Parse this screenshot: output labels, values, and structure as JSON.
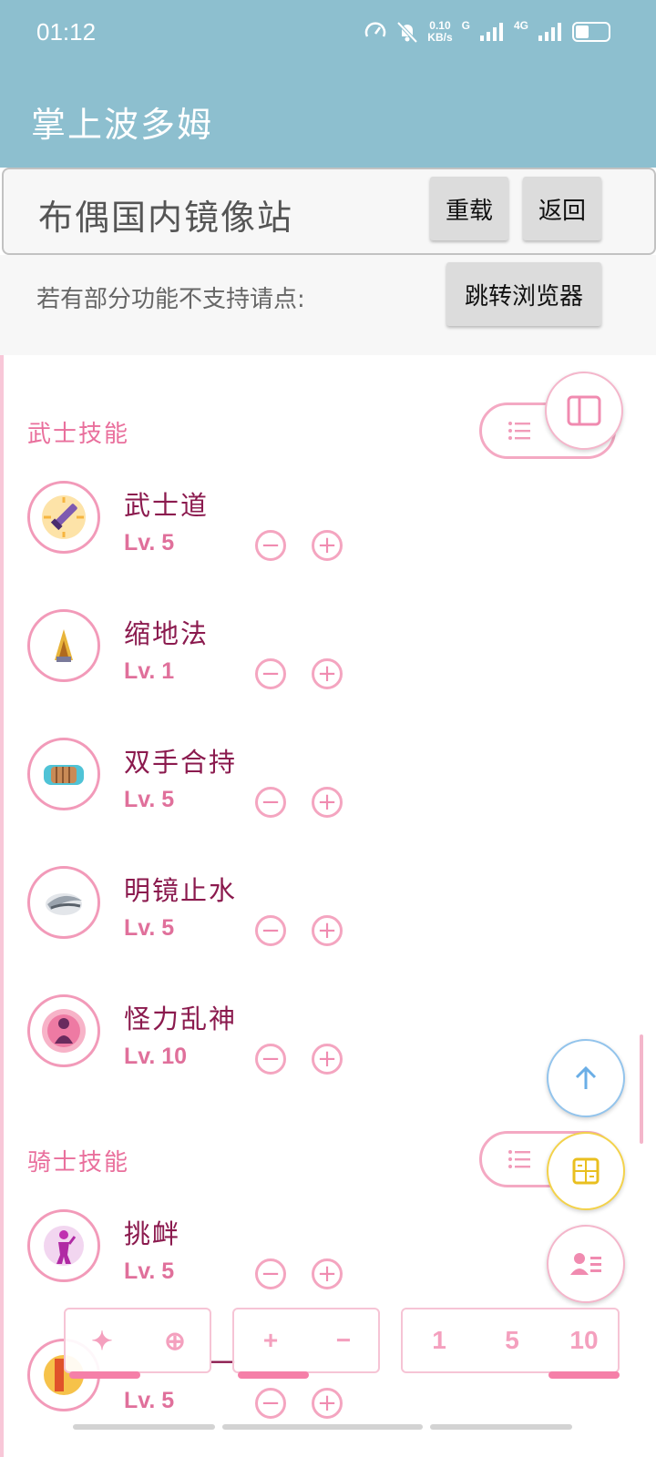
{
  "status": {
    "time": "01:12",
    "speed_value": "0.10",
    "speed_unit": "KB/s",
    "net1": "G",
    "net2": "4G"
  },
  "app": {
    "title": "掌上波多姆"
  },
  "mirror": {
    "title": "布偶国内镜像站",
    "reload_label": "重载",
    "back_label": "返回"
  },
  "notice": {
    "text": "若有部分功能不支持请点:",
    "browser_button": "跳转浏览器"
  },
  "sections": [
    {
      "title": "武士技能",
      "skills": [
        {
          "name": "武士道",
          "level": "Lv. 5"
        },
        {
          "name": "缩地法",
          "level": "Lv. 1"
        },
        {
          "name": "双手合持",
          "level": "Lv. 5"
        },
        {
          "name": "明镜止水",
          "level": "Lv. 5"
        },
        {
          "name": "怪力乱神",
          "level": "Lv. 10"
        }
      ]
    },
    {
      "title": "骑士技能",
      "skills": [
        {
          "name": "挑衅",
          "level": "Lv. 5"
        },
        {
          "name": "一",
          "level": "Lv. 5"
        }
      ]
    }
  ],
  "controls": {
    "minus": "−",
    "plus": "+"
  },
  "bottom_bar": {
    "mode_group": [
      "✦",
      "⊕"
    ],
    "op_group": [
      "+",
      "−"
    ],
    "step_group": [
      "1",
      "5",
      "10"
    ]
  },
  "colors": {
    "appbar": "#8dbfcf",
    "accent": "#e96f9c",
    "skill_name": "#8b1a4e"
  }
}
